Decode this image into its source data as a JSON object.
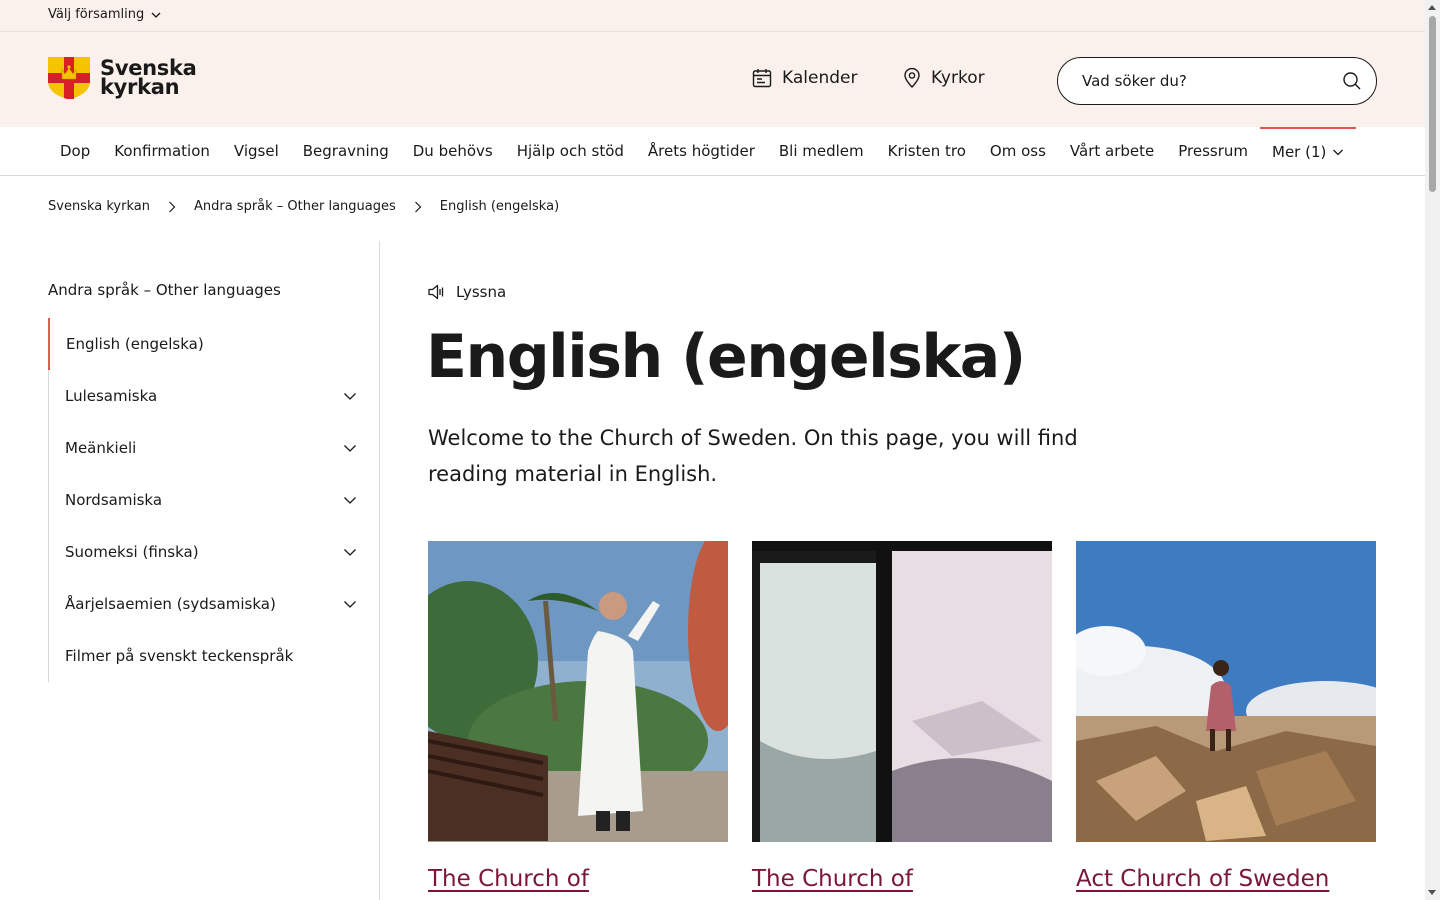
{
  "parish": {
    "label": "Välj församling"
  },
  "header": {
    "logo_line1": "Svenska",
    "logo_line2": "kyrkan",
    "calendar_label": "Kalender",
    "churches_label": "Kyrkor",
    "search_placeholder": "Vad söker du?"
  },
  "nav": {
    "items": [
      "Dop",
      "Konfirmation",
      "Vigsel",
      "Begravning",
      "Du behövs",
      "Hjälp och stöd",
      "Årets högtider",
      "Bli medlem",
      "Kristen tro",
      "Om oss",
      "Vårt arbete",
      "Pressrum"
    ],
    "more_label": "Mer (1)"
  },
  "breadcrumb": [
    "Svenska kyrkan",
    "Andra språk – Other languages",
    "English (engelska)"
  ],
  "sidebar": {
    "title": "Andra språk – Other languages",
    "items": [
      {
        "label": "English (engelska)"
      },
      {
        "label": "Lulesamiska"
      },
      {
        "label": "Meänkieli"
      },
      {
        "label": "Nordsamiska"
      },
      {
        "label": "Suomeksi (finska)"
      },
      {
        "label": "Åarjelsaemien (sydsamiska)"
      },
      {
        "label": "Filmer på svenskt teckenspråk"
      }
    ]
  },
  "content": {
    "listen_label": "Lyssna",
    "title": "English (engelska)",
    "intro": "Welcome to the Church of Sweden. On this page, you will find reading material in English."
  },
  "cards": [
    {
      "title": "The Church of"
    },
    {
      "title": "The Church of"
    },
    {
      "title": "Act Church of Sweden"
    }
  ],
  "colors": {
    "accent": "#e05a4e",
    "link": "#7a1638",
    "header_bg": "#fbf1ec"
  }
}
